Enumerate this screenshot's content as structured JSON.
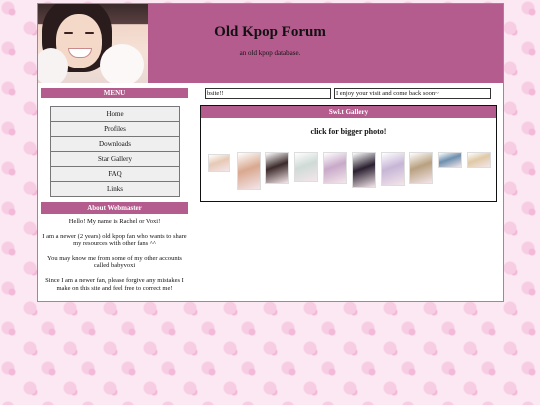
{
  "header": {
    "title": "Old Kpop Forum",
    "subtitle": "an old kpop database."
  },
  "menu": {
    "heading": "MENU",
    "items": [
      {
        "label": "Home"
      },
      {
        "label": "Profiles"
      },
      {
        "label": "Downloads"
      },
      {
        "label": "Star Gallery"
      },
      {
        "label": "FAQ"
      },
      {
        "label": "Links"
      }
    ]
  },
  "about": {
    "heading": "About Webmaster",
    "paragraphs": [
      "Hello! My name is Rachel or Voxi!",
      "I am a newer (2 years) old kpop fan who wants to share my resources with other fans ^^",
      "You may know me from some of my other accounts called babyvoxi",
      "Since I am a newer fan, please forgive any mistakes I make on this site and feel free to correct me!"
    ]
  },
  "marquee": {
    "left": "bsite!!",
    "right": "I enjoy your visit and come back soon~"
  },
  "gallery": {
    "heading": "Swi.t Gallery",
    "caption": "click for bigger photo!",
    "thumbnails": [
      {
        "label": "photo-1",
        "color": "#e7c9b5"
      },
      {
        "label": "photo-2",
        "color": "#d9a88f"
      },
      {
        "label": "photo-3",
        "color": "#3d2b2b"
      },
      {
        "label": "photo-4",
        "color": "#cfdad6"
      },
      {
        "label": "photo-5",
        "color": "#c8a9c9"
      },
      {
        "label": "photo-6",
        "color": "#2a2030"
      },
      {
        "label": "photo-7",
        "color": "#c7b5d6"
      },
      {
        "label": "photo-8",
        "color": "#b8a080"
      },
      {
        "label": "photo-9",
        "color": "#6d8fae"
      },
      {
        "label": "photo-10",
        "color": "#e0c9a6"
      }
    ]
  },
  "colors": {
    "accent": "#b55c8e",
    "menu_bg": "#efefef",
    "page_bg": "#fbe8f3"
  }
}
